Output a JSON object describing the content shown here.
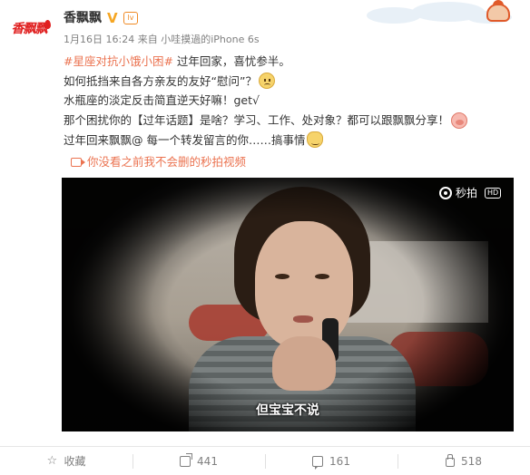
{
  "post": {
    "avatar_text": "香飘飘",
    "nickname": "香飘飘",
    "verified_badge": "V",
    "level_badge": "lv",
    "time": "1月16日 16:24",
    "source_prefix": "来自",
    "source": "小哇摸過的iPhone 6s",
    "lines": {
      "l1_tag": "#星座对抗小饿小困#",
      "l1_text": " 过年回家，喜忧参半。",
      "l2": "如何抵挡来自各方亲友的友好“慰问”？",
      "l3": "水瓶座的淡定反击简直逆天好嘛！get√",
      "l4": "那个困扰你的【过年话题】是啥？学习、工作、处对象？都可以跟飘飘分享！",
      "l5_text": "过年回来飘飘@ 每一个转发留言的你……搞事情"
    },
    "emoji_icons": [
      "sad-emoji-icon",
      "pig-emoji-icon",
      "cat-emoji-icon"
    ],
    "video_link": "你没看之前我不会删的秒拍视频"
  },
  "video": {
    "brand": "秒拍",
    "quality": "HD",
    "subtitle": "但宝宝不说"
  },
  "actions": {
    "favorite": "收藏",
    "share_count": "441",
    "comment_count": "161",
    "like_count": "518"
  },
  "colors": {
    "link": "#eb7350",
    "brand_red": "#e02020",
    "meta_gray": "#808080"
  }
}
